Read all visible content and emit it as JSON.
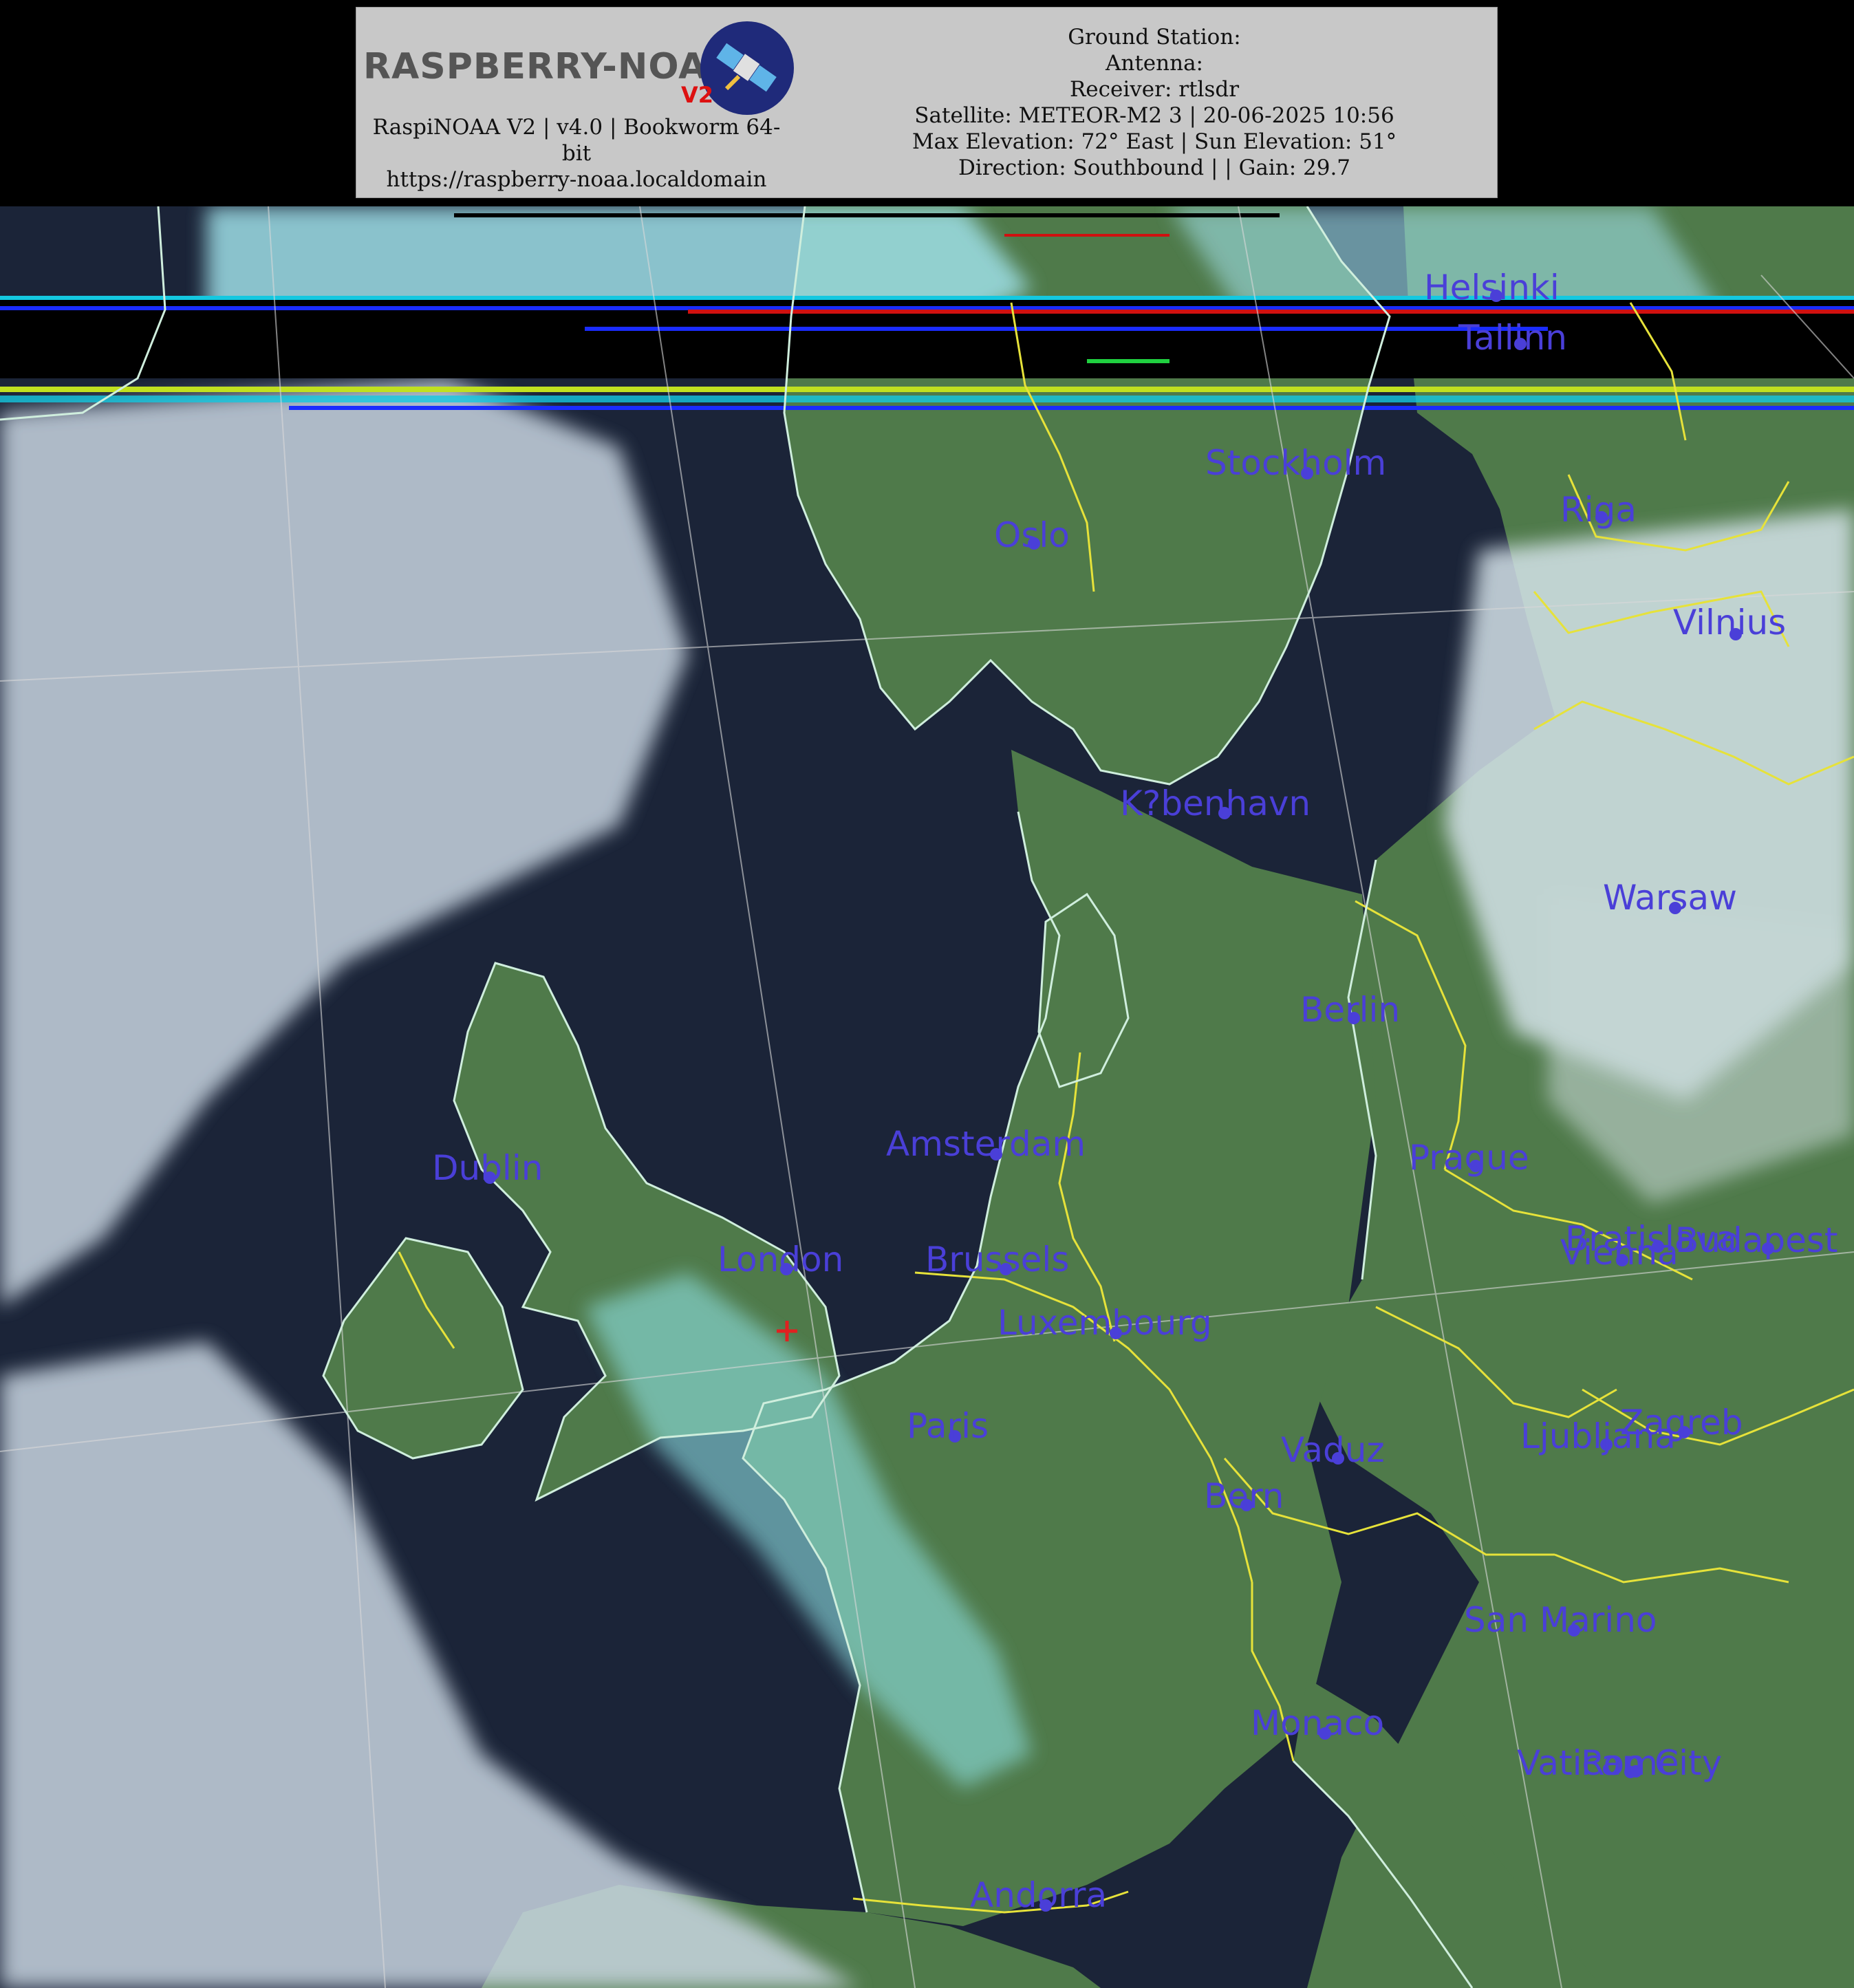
{
  "header": {
    "logo_text": "RASPBERRY-NOAA",
    "logo_version": "V2",
    "software_line_1": "RaspiNOAA V2 | v4.0 | Bookworm 64-",
    "software_line_2": "bit",
    "url": "https://raspberry-noaa.localdomain",
    "ground_station": "Ground Station:",
    "antenna": "Antenna:",
    "receiver": "Receiver: rtlsdr",
    "satellite_line": "Satellite: METEOR-M2 3 | 20-06-2025 10:56",
    "elevation_line": "Max Elevation: 72° East | Sun Elevation: 51°",
    "direction_line": "Direction: Southbound | | Gain: 29.7"
  },
  "map": {
    "colors": {
      "land": "#4f7a4a",
      "sea": "#1b2438",
      "cloud": "#c9d6e2",
      "cloud_cyan": "#8fe3e6",
      "coastline": "#cfeedd",
      "border": "#e6e23a",
      "label": "#4a3fd8",
      "graticule": "#d8d8d8",
      "station_marker": "#e02020"
    },
    "cities": [
      {
        "name": "Helsinki"
      },
      {
        "name": "Tallinn"
      },
      {
        "name": "Stockholm"
      },
      {
        "name": "Riga"
      },
      {
        "name": "Oslo"
      },
      {
        "name": "Vilnius"
      },
      {
        "name": "K?benhavn"
      },
      {
        "name": "Warsaw"
      },
      {
        "name": "Berlin"
      },
      {
        "name": "Amsterdam"
      },
      {
        "name": "Dublin"
      },
      {
        "name": "Prague"
      },
      {
        "name": "London"
      },
      {
        "name": "Brussels"
      },
      {
        "name": "Vienna"
      },
      {
        "name": "Bratislava"
      },
      {
        "name": "Budapest"
      },
      {
        "name": "Luxembourg"
      },
      {
        "name": "Paris"
      },
      {
        "name": "Vaduz"
      },
      {
        "name": "Ljubljana"
      },
      {
        "name": "Zagreb"
      },
      {
        "name": "Bern"
      },
      {
        "name": "San Marino"
      },
      {
        "name": "Monaco"
      },
      {
        "name": "Vatican City"
      },
      {
        "name": "Rome"
      },
      {
        "name": "Andorra"
      }
    ]
  }
}
